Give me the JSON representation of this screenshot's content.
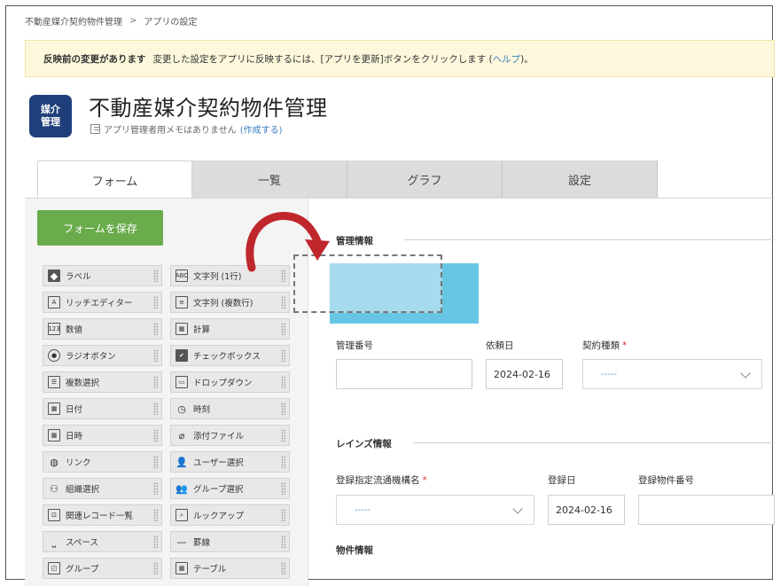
{
  "breadcrumb": {
    "root": "不動産媒介契約物件管理",
    "separator": ">",
    "current": "アプリの設定"
  },
  "alert": {
    "heading": "反映前の変更があります",
    "message": "変更した設定をアプリに反映するには、[アプリを更新]ボタンをクリックします",
    "link_open": "(",
    "link_text": "ヘルプ",
    "link_close": ")。"
  },
  "app": {
    "icon_text_line1": "媒介",
    "icon_text_line2": "管理",
    "title": "不動産媒介契約物件管理",
    "memo_text": "アプリ管理者用メモはありません",
    "memo_link": "(作成する)",
    "icon_color": "#1e3f7a"
  },
  "tabs": [
    "フォーム",
    "一覧",
    "グラフ",
    "設定"
  ],
  "save_button": "フォームを保存",
  "palette_left": [
    {
      "icon": "tag-icon",
      "glyph": "◆",
      "label": "ラベル"
    },
    {
      "icon": "rich-editor-icon",
      "glyph": "A",
      "label": "リッチエディター"
    },
    {
      "icon": "number-icon",
      "glyph": "123",
      "label": "数値"
    },
    {
      "icon": "radio-icon",
      "glyph": "●",
      "label": "ラジオボタン"
    },
    {
      "icon": "multi-select-icon",
      "glyph": "☰",
      "label": "複数選択"
    },
    {
      "icon": "date-icon",
      "glyph": "▦",
      "label": "日付"
    },
    {
      "icon": "datetime-icon",
      "glyph": "▦",
      "label": "日時"
    },
    {
      "icon": "link-icon",
      "glyph": "◍",
      "label": "リンク"
    },
    {
      "icon": "org-select-icon",
      "glyph": "⚇",
      "label": "組織選択"
    },
    {
      "icon": "related-records-icon",
      "glyph": "⊡",
      "label": "関連レコード一覧"
    },
    {
      "icon": "space-icon",
      "glyph": "⎵",
      "label": "スペース"
    },
    {
      "icon": "group-icon",
      "glyph": "◰",
      "label": "グループ"
    }
  ],
  "palette_right": [
    {
      "icon": "text-single-icon",
      "glyph": "ABC",
      "label": "文字列 (1行)"
    },
    {
      "icon": "text-multi-icon",
      "glyph": "≡",
      "label": "文字列 (複数行)"
    },
    {
      "icon": "calc-icon",
      "glyph": "▦",
      "label": "計算"
    },
    {
      "icon": "checkbox-icon",
      "glyph": "✔",
      "label": "チェックボックス"
    },
    {
      "icon": "dropdown-icon",
      "glyph": "▭",
      "label": "ドロップダウン"
    },
    {
      "icon": "time-icon",
      "glyph": "◷",
      "label": "時刻"
    },
    {
      "icon": "attachment-icon",
      "glyph": "⌀",
      "label": "添付ファイル"
    },
    {
      "icon": "user-select-icon",
      "glyph": "👤",
      "label": "ユーザー選択"
    },
    {
      "icon": "group-select-icon",
      "glyph": "👥",
      "label": "グループ選択"
    },
    {
      "icon": "lookup-icon",
      "glyph": "⌕",
      "label": "ルックアップ"
    },
    {
      "icon": "divider-icon",
      "glyph": "—",
      "label": "罫線"
    },
    {
      "icon": "table-icon",
      "glyph": "▦",
      "label": "テーブル"
    }
  ],
  "form": {
    "section_management": "管理情報",
    "field_management_no": {
      "label": "管理番号",
      "value": ""
    },
    "field_request_date": {
      "label": "依頼日",
      "value": "2024-02-16"
    },
    "field_contract_type": {
      "label": "契約種類",
      "required": "*",
      "value": "-----"
    },
    "section_reins": "レインズ情報",
    "field_registration_org": {
      "label": "登録指定流通機構名",
      "required": "*",
      "value": "-----"
    },
    "field_registration_date": {
      "label": "登録日",
      "value": "2024-02-16"
    },
    "field_registration_no": {
      "label": "登録物件番号",
      "value": ""
    },
    "section_property": "物件情報"
  },
  "colors": {
    "accent_green": "#6aac4c",
    "highlight_blue": "#66c6e3",
    "arrow_red": "#c0272d",
    "required_red": "#d9363e"
  }
}
